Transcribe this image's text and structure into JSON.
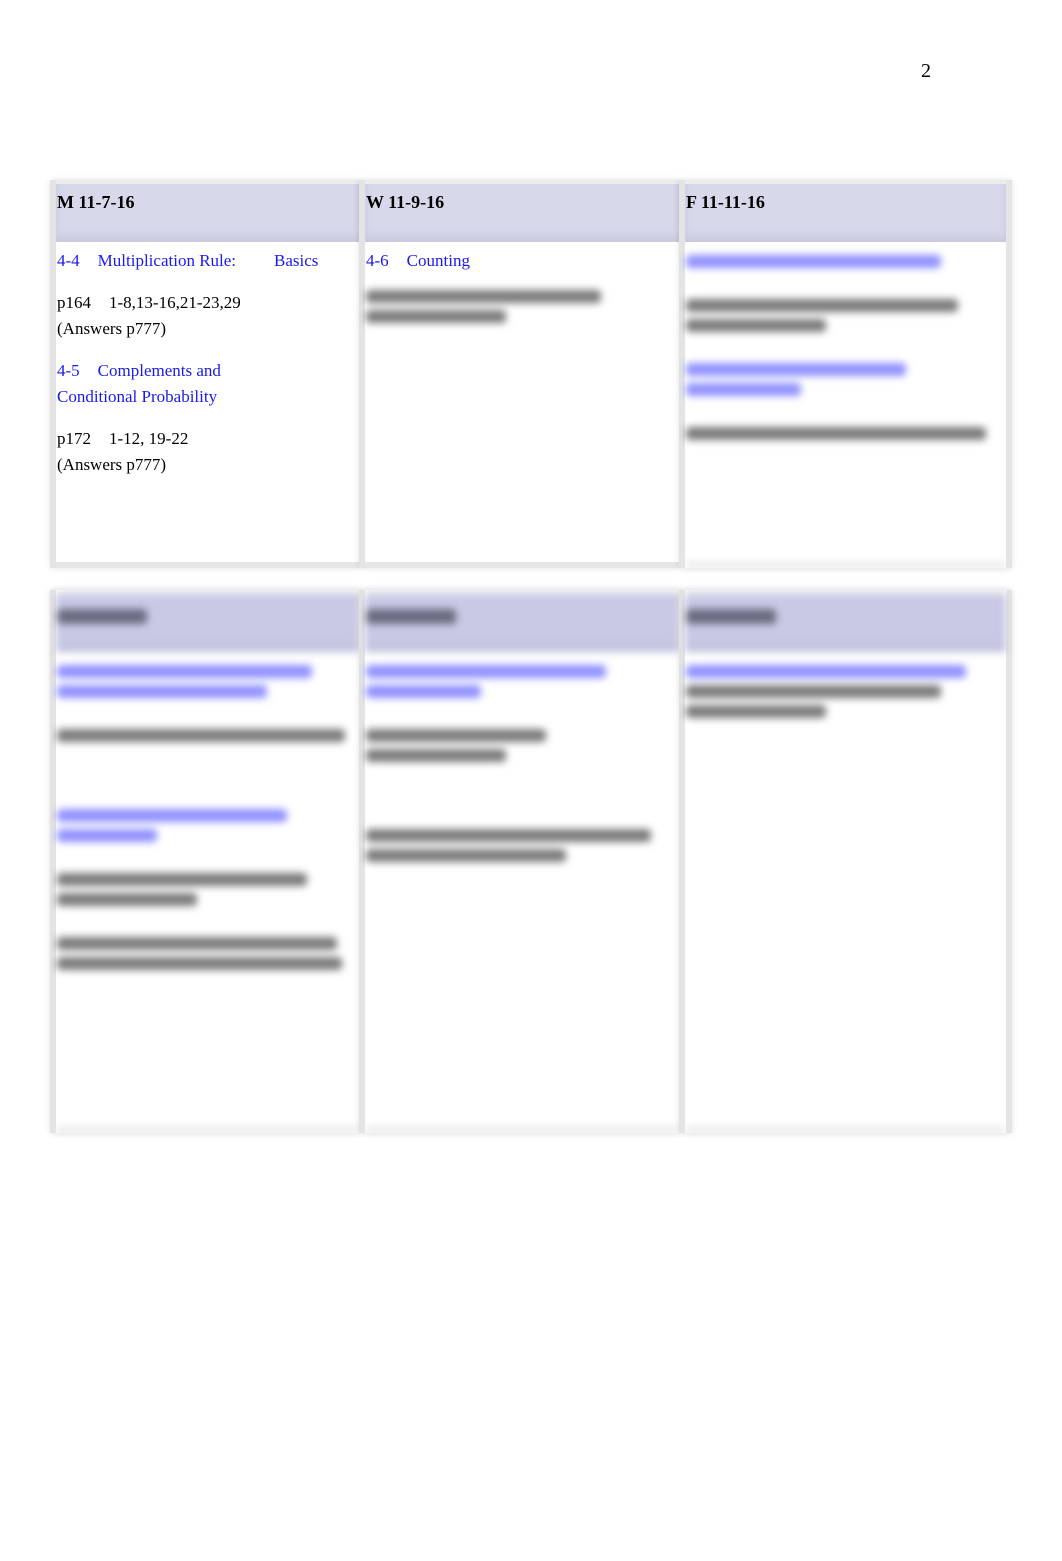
{
  "page_number": "2",
  "week1": {
    "columns": [
      {
        "header": "M 11-7-16",
        "entries": [
          {
            "section": "4-4",
            "title": "Multiplication Rule:",
            "title_extra": "Basics",
            "assignment_page": "p164",
            "assignment_problems": "1-8,13-16,21-23,29",
            "answers": "(Answers p777)"
          },
          {
            "section": "4-5",
            "title": "Complements and",
            "title_line2": "Conditional Probability",
            "assignment_page": "p172",
            "assignment_problems": "1-12, 19-22",
            "answers": "(Answers p777)"
          }
        ]
      },
      {
        "header": "W 11-9-16",
        "entries": [
          {
            "section": "4-6",
            "title": "Counting",
            "obscured_assignment": true
          }
        ]
      },
      {
        "header": "F 11-11-16",
        "obscured": true
      }
    ]
  },
  "week2": {
    "obscured": true,
    "columns": [
      {
        "obscured": true
      },
      {
        "obscured": true
      },
      {
        "obscured": true
      }
    ]
  },
  "colors": {
    "header_bg": "#d7d8ea",
    "link": "#1a1aee",
    "text": "#000000"
  }
}
